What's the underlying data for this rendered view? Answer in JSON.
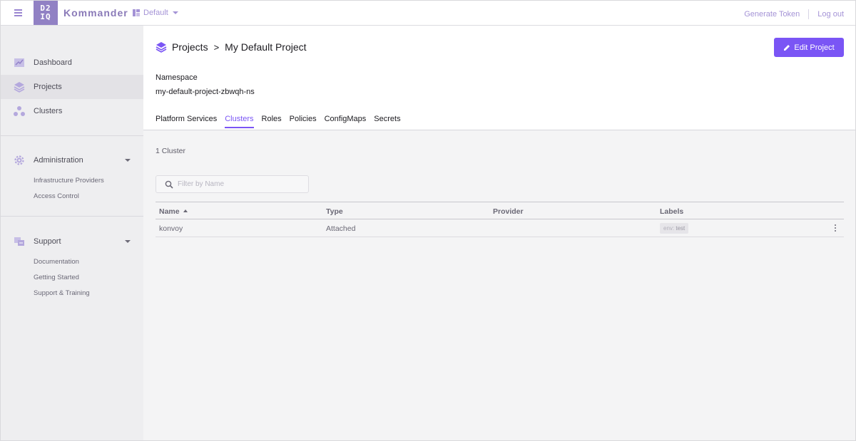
{
  "topbar": {
    "brand": "Kommander",
    "logo_line1": "D2",
    "logo_line2": "IQ",
    "workspace": "Default",
    "generate_token": "Generate Token",
    "logout": "Log out"
  },
  "sidebar": {
    "items": [
      {
        "label": "Dashboard",
        "icon": "dashboard-icon"
      },
      {
        "label": "Projects",
        "icon": "projects-icon",
        "active": true
      },
      {
        "label": "Clusters",
        "icon": "clusters-icon"
      }
    ],
    "administration": {
      "label": "Administration",
      "icon": "gear-icon",
      "subitems": [
        "Infrastructure Providers",
        "Access Control"
      ]
    },
    "support": {
      "label": "Support",
      "icon": "support-icon",
      "subitems": [
        "Documentation",
        "Getting Started",
        "Support & Training"
      ]
    }
  },
  "header": {
    "breadcrumb_root": "Projects",
    "breadcrumb_separator": ">",
    "breadcrumb_current": "My Default Project",
    "edit_button": "Edit Project",
    "namespace_label": "Namespace",
    "namespace_value": "my-default-project-zbwqh-ns",
    "tabs": [
      {
        "label": "Platform Services"
      },
      {
        "label": "Clusters",
        "active": true
      },
      {
        "label": "Roles"
      },
      {
        "label": "Policies"
      },
      {
        "label": "ConfigMaps"
      },
      {
        "label": "Secrets"
      }
    ]
  },
  "content": {
    "count": "1 Cluster",
    "filter_placeholder": "Filter by Name",
    "columns": [
      "Name",
      "Type",
      "Provider",
      "Labels"
    ],
    "rows": [
      {
        "name": "konvoy",
        "type": "Attached",
        "provider": "",
        "label_key": "env:",
        "label_value": "test"
      }
    ]
  },
  "colors": {
    "accent": "#7a55f5",
    "brand": "#9181c4",
    "sidebar_bg": "#eeeef0"
  }
}
